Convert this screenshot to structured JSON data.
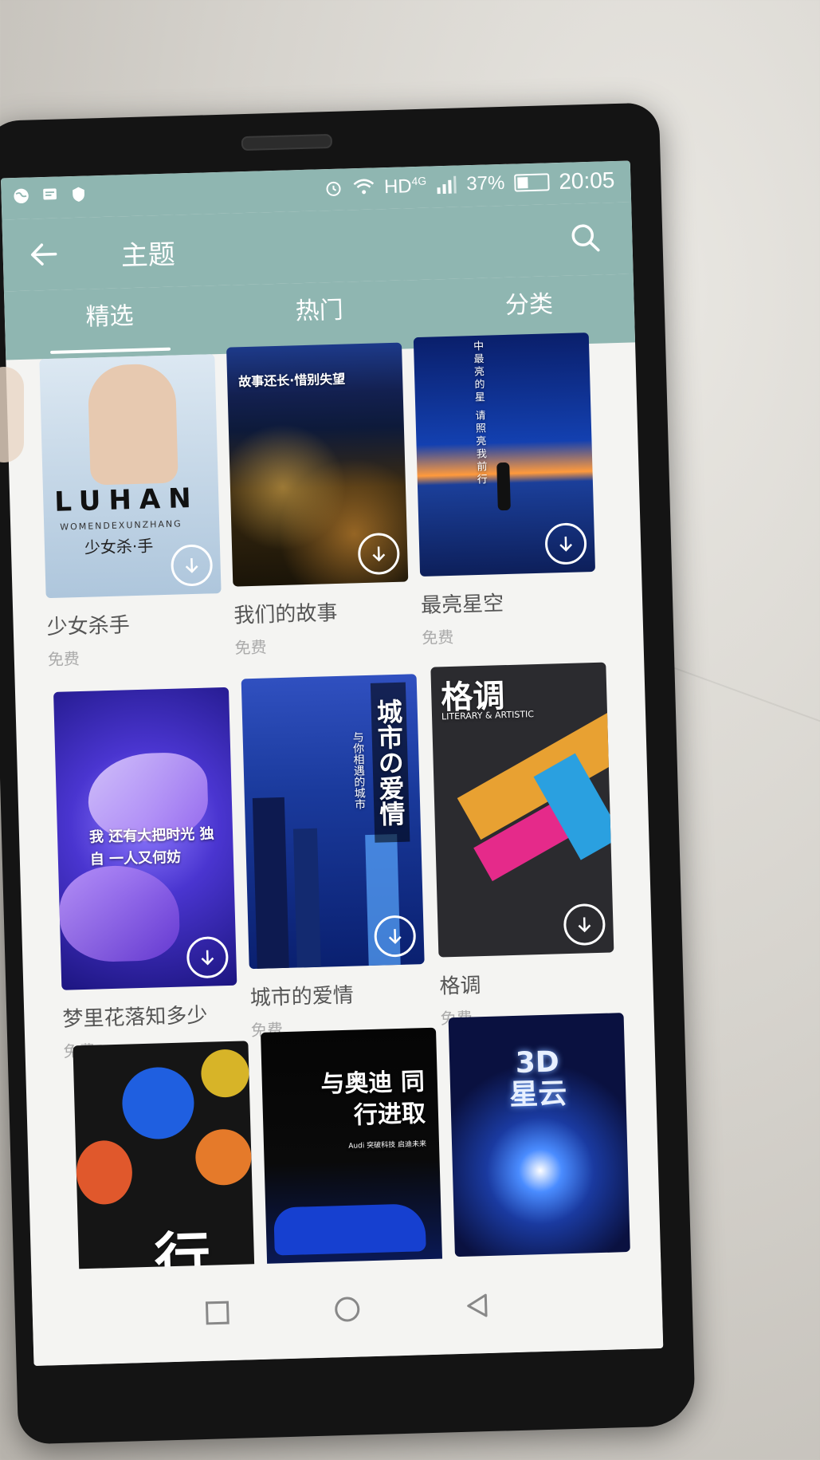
{
  "status": {
    "network": "HD",
    "network_type": "4G",
    "battery": "37%",
    "battery_level": 0.37,
    "time": "20:05",
    "icons_left": [
      "globe-icon",
      "message-icon",
      "shield-icon"
    ],
    "icons_right": [
      "alarm-icon",
      "wifi-icon",
      "signal-icon",
      "battery-icon"
    ]
  },
  "appbar": {
    "title": "主题"
  },
  "tabs": [
    {
      "label": "精选",
      "active": true
    },
    {
      "label": "热门",
      "active": false
    },
    {
      "label": "分类",
      "active": false
    }
  ],
  "items": [
    {
      "name": "少女杀手",
      "price": "免费",
      "art_text": "LUHAN",
      "art_sub": "WOMENDEXUNZHANG",
      "art_sub2": "少女杀·手",
      "bg": "#cfe0ef"
    },
    {
      "name": "我们的故事",
      "price": "免费",
      "art_text": "故事还长·惜别失望",
      "bg": "#1a2a5a"
    },
    {
      "name": "最亮星空",
      "price": "免费",
      "art_text": "中最亮的星 请照亮我前行",
      "bg": "#0a1f6b"
    },
    {
      "name": "梦里花落知多少",
      "price": "免费",
      "art_text": "我 还有大把时光 独自 一人又何妨",
      "bg": "#3a2fb8"
    },
    {
      "name": "城市的爱情",
      "price": "免费",
      "art_text": "城市の爱情",
      "art_sub": "与你相遇的城市",
      "bg": "#1c3a8c"
    },
    {
      "name": "格调",
      "price": "免费",
      "art_text": "格调",
      "art_sub": "LITERARY & ARTISTIC",
      "bg": "#2a2a2a"
    },
    {
      "name": "",
      "price": "",
      "art_text": "行",
      "bg": "#1a1a1a"
    },
    {
      "name": "",
      "price": "",
      "art_text": "与奥迪 同行进取",
      "art_sub": "Audi 突破科技 启迪未来",
      "bg": "#0a0a0a"
    },
    {
      "name": "",
      "price": "",
      "art_text": "3D星云",
      "bg": "#0a1140"
    }
  ]
}
